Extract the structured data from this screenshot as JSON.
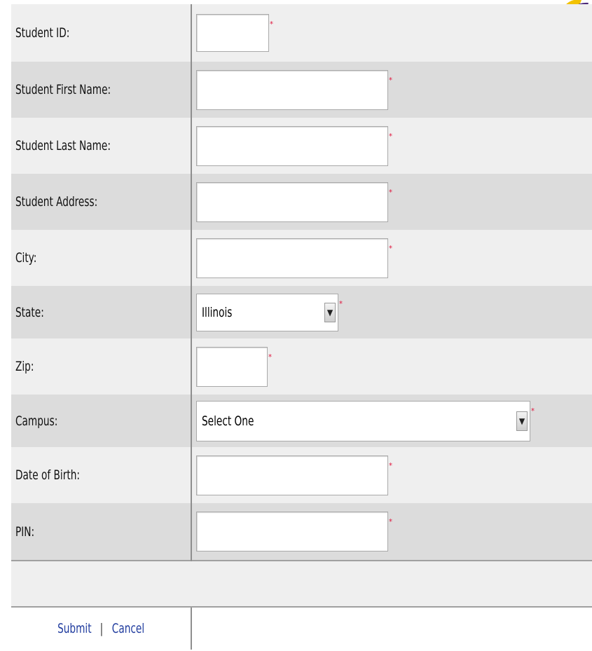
{
  "form": {
    "fields": [
      {
        "label": "Student ID:",
        "type": "text",
        "value": "",
        "width": 104,
        "required_mark": "*"
      },
      {
        "label": "Student First Name:",
        "type": "text",
        "value": "",
        "width": 274,
        "required_mark": "*"
      },
      {
        "label": "Student Last Name:",
        "type": "text",
        "value": "",
        "width": 274,
        "required_mark": "*"
      },
      {
        "label": "Student Address:",
        "type": "text",
        "value": "",
        "width": 274,
        "required_mark": "*"
      },
      {
        "label": "City:",
        "type": "text",
        "value": "",
        "width": 274,
        "required_mark": "*"
      },
      {
        "label": "State:",
        "type": "select",
        "value": "Illinois",
        "width": 203,
        "required_mark": "*"
      },
      {
        "label": "Zip:",
        "type": "text",
        "value": "",
        "width": 102,
        "required_mark": "*"
      },
      {
        "label": "Campus:",
        "type": "select",
        "value": "Select One",
        "width": 477,
        "required_mark": "*"
      },
      {
        "label": "Date of Birth:",
        "type": "text",
        "value": "",
        "width": 274,
        "required_mark": "*"
      },
      {
        "label": "PIN:",
        "type": "text",
        "value": "",
        "width": 274,
        "required_mark": "*"
      }
    ]
  },
  "actions": {
    "submit_label": "Submit",
    "separator": "|",
    "cancel_label": "Cancel"
  },
  "colors": {
    "row_light": "#efefef",
    "row_dark": "#dcdcdc",
    "required": "#e0143c",
    "link": "#1f3b9e"
  }
}
